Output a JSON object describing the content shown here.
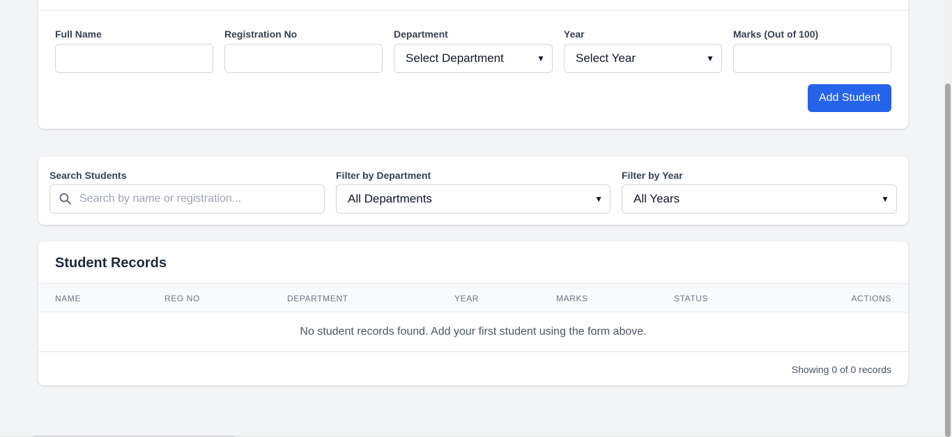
{
  "form": {
    "full_name": {
      "label": "Full Name",
      "value": ""
    },
    "registration_no": {
      "label": "Registration No",
      "value": ""
    },
    "department": {
      "label": "Department",
      "selected": "Select Department"
    },
    "year": {
      "label": "Year",
      "selected": "Select Year"
    },
    "marks": {
      "label": "Marks (Out of 100)",
      "value": ""
    },
    "submit_label": "Add Student"
  },
  "filters": {
    "search": {
      "label": "Search Students",
      "placeholder": "Search by name or registration..."
    },
    "department": {
      "label": "Filter by Department",
      "selected": "All Departments"
    },
    "year": {
      "label": "Filter by Year",
      "selected": "All Years"
    }
  },
  "records": {
    "title": "Student Records",
    "columns": [
      "NAME",
      "REG NO",
      "DEPARTMENT",
      "YEAR",
      "MARKS",
      "STATUS",
      "ACTIONS"
    ],
    "empty_message": "No student records found. Add your first student using the form above.",
    "summary": "Showing 0 of 0 records"
  },
  "icons": {
    "search": "search-icon",
    "dropdown": "chevron-down-icon"
  },
  "colors": {
    "accent": "#2563eb",
    "background": "#f3f4f6"
  }
}
